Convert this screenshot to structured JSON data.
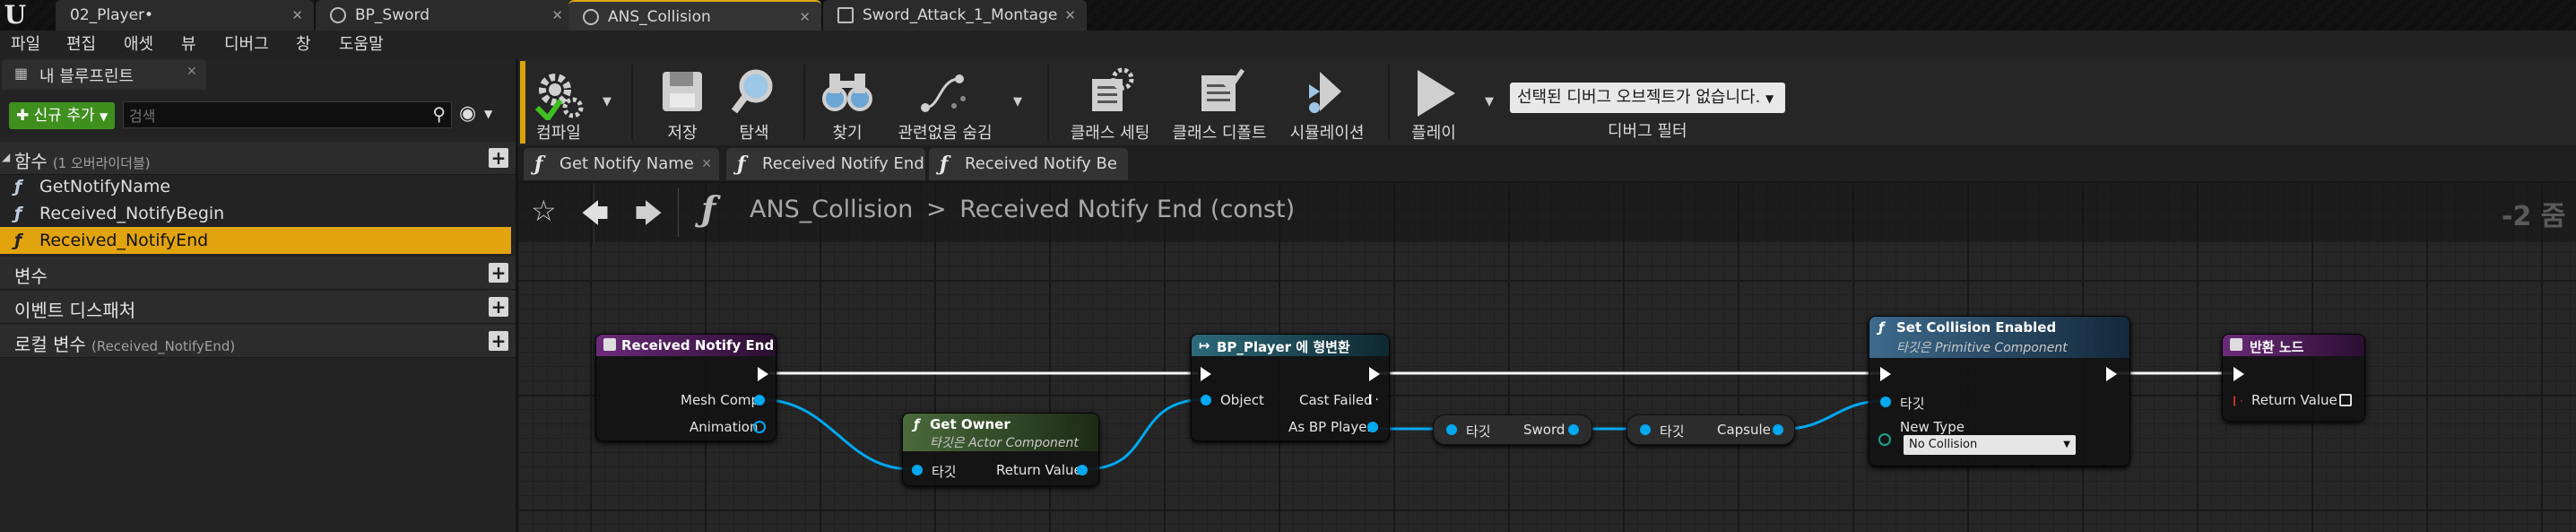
{
  "app": {
    "logo": "U"
  },
  "tabs": [
    {
      "label": "02_Player•"
    },
    {
      "label": "BP_Sword"
    },
    {
      "label": "ANS_Collision"
    },
    {
      "label": "Sword_Attack_1_Montage"
    }
  ],
  "tab_close": "✕",
  "menu": [
    "파일",
    "편집",
    "애셋",
    "뷰",
    "디버그",
    "창",
    "도움말"
  ],
  "left_panel": {
    "tab_label": "내 블루프린트",
    "add_button": "신규 추가",
    "search_placeholder": "검색",
    "functions": {
      "label": "함수",
      "sub": "(1 오버라이더블)"
    },
    "function_items": [
      "GetNotifyName",
      "Received_NotifyBegin",
      "Received_NotifyEnd"
    ],
    "variables": "변수",
    "dispatchers": "이벤트 디스패처",
    "local_vars": {
      "label": "로컬 변수",
      "sub": "(Received_NotifyEnd)"
    }
  },
  "toolbar": {
    "compile": "컴파일",
    "save": "저장",
    "browse": "탐색",
    "find": "찾기",
    "hide_unrelated": "관련없음 숨김",
    "class_settings": "클래스 세팅",
    "class_defaults": "클래스 디폴트",
    "simulation": "시뮬레이션",
    "play": "플레이",
    "debug_object": "선택된 디버그 오브젝트가 없습니다.",
    "debug_filter": "디버그 필터"
  },
  "graph_tabs": [
    "Get Notify Name",
    "Received Notify End",
    "Received Notify Be"
  ],
  "breadcrumb": {
    "root": "ANS_Collision",
    "sep": ">",
    "current": "Received Notify End (const)"
  },
  "zoom": "-2 줌",
  "nodes": {
    "entry": {
      "title": "Received Notify End",
      "pins": [
        "Mesh Comp",
        "Animation"
      ]
    },
    "get_owner": {
      "title": "Get Owner",
      "sub": "타깃은 Actor Component",
      "in": "타깃",
      "out": "Return Value"
    },
    "cast": {
      "title": "BP_Player 에 형변환",
      "in": "Object",
      "out1": "Cast Failed",
      "out2": "As BP Player"
    },
    "get_sword": {
      "in": "타깃",
      "out": "Sword"
    },
    "get_capsule": {
      "in": "타깃",
      "out": "Capsule"
    },
    "set_collision": {
      "title": "Set Collision Enabled",
      "sub": "타깃은 Primitive Component",
      "in": "타깃",
      "param": "New Type",
      "value": "No Collision"
    },
    "return": {
      "title": "반환 노드",
      "out": "Return Value"
    }
  },
  "colors": {
    "accent": "#e2a40e",
    "add_button": "#3f8f1f",
    "pin_object": "#00a8f0",
    "pure_node": "#4a6b3a",
    "func_node": "#3d6a8c",
    "event_node": "#6b2a7a"
  }
}
